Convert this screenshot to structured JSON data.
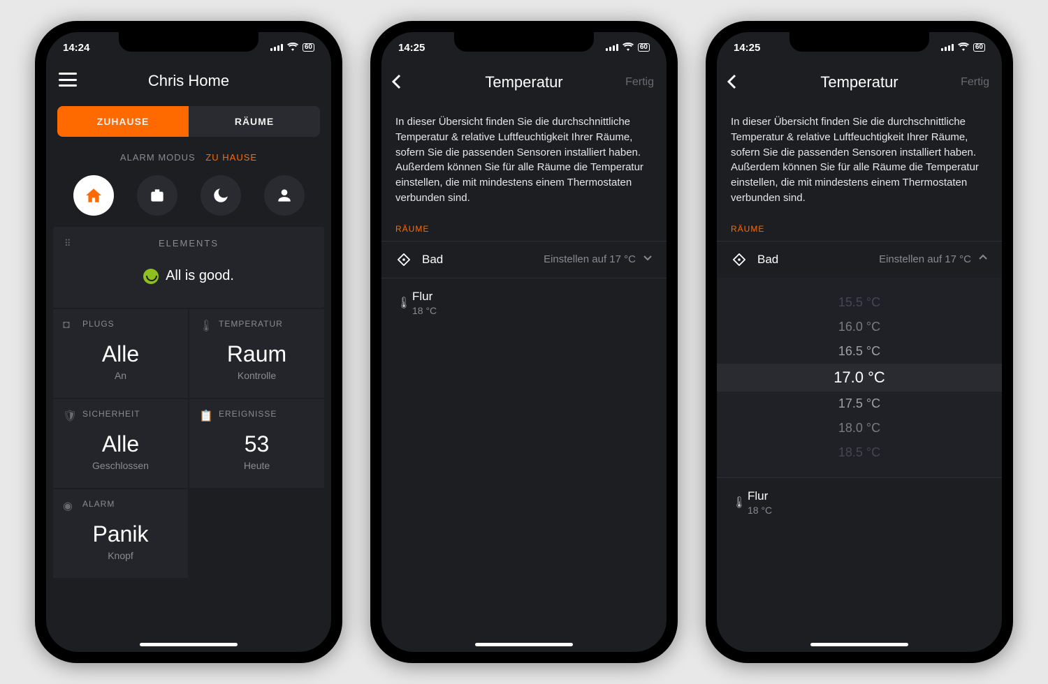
{
  "status": {
    "time_a": "14:24",
    "time_b": "14:25",
    "battery": "60"
  },
  "screen1": {
    "title": "Chris Home",
    "tabs": {
      "left": "ZUHAUSE",
      "right": "RÄUME"
    },
    "modeLabel": "ALARM MODUS",
    "modeCurrent": "ZU HAUSE",
    "elements": {
      "title": "ELEMENTS",
      "msg": "All is good."
    },
    "tiles": {
      "plugs": {
        "label": "PLUGS",
        "big": "Alle",
        "sub": "An"
      },
      "temp": {
        "label": "TEMPERATUR",
        "big": "Raum",
        "sub": "Kontrolle"
      },
      "sec": {
        "label": "SICHERHEIT",
        "big": "Alle",
        "sub": "Geschlossen"
      },
      "events": {
        "label": "EREIGNISSE",
        "big": "53",
        "sub": "Heute"
      },
      "alarm": {
        "label": "ALARM",
        "big": "Panik",
        "sub": "Knopf"
      }
    }
  },
  "screen2": {
    "title": "Temperatur",
    "done": "Fertig",
    "desc": "In dieser Übersicht finden Sie die durchschnittliche Temperatur & relative Luftfeuchtigkeit Ihrer Räume, sofern Sie die passenden Sensoren installiert haben. Außerdem können Sie für alle Räume die Temperatur einstellen, die mit mindestens einem Thermostaten verbunden sind.",
    "section": "RÄUME",
    "rooms": {
      "bad": {
        "name": "Bad",
        "set": "Einstellen auf 17 °C"
      },
      "flur": {
        "name": "Flur",
        "value": "18 °C"
      }
    }
  },
  "picker": {
    "opts": [
      "15.5 °C",
      "16.0 °C",
      "16.5 °C",
      "17.0 °C",
      "17.5 °C",
      "18.0 °C",
      "18.5 °C"
    ],
    "selected": "17.0 °C"
  }
}
